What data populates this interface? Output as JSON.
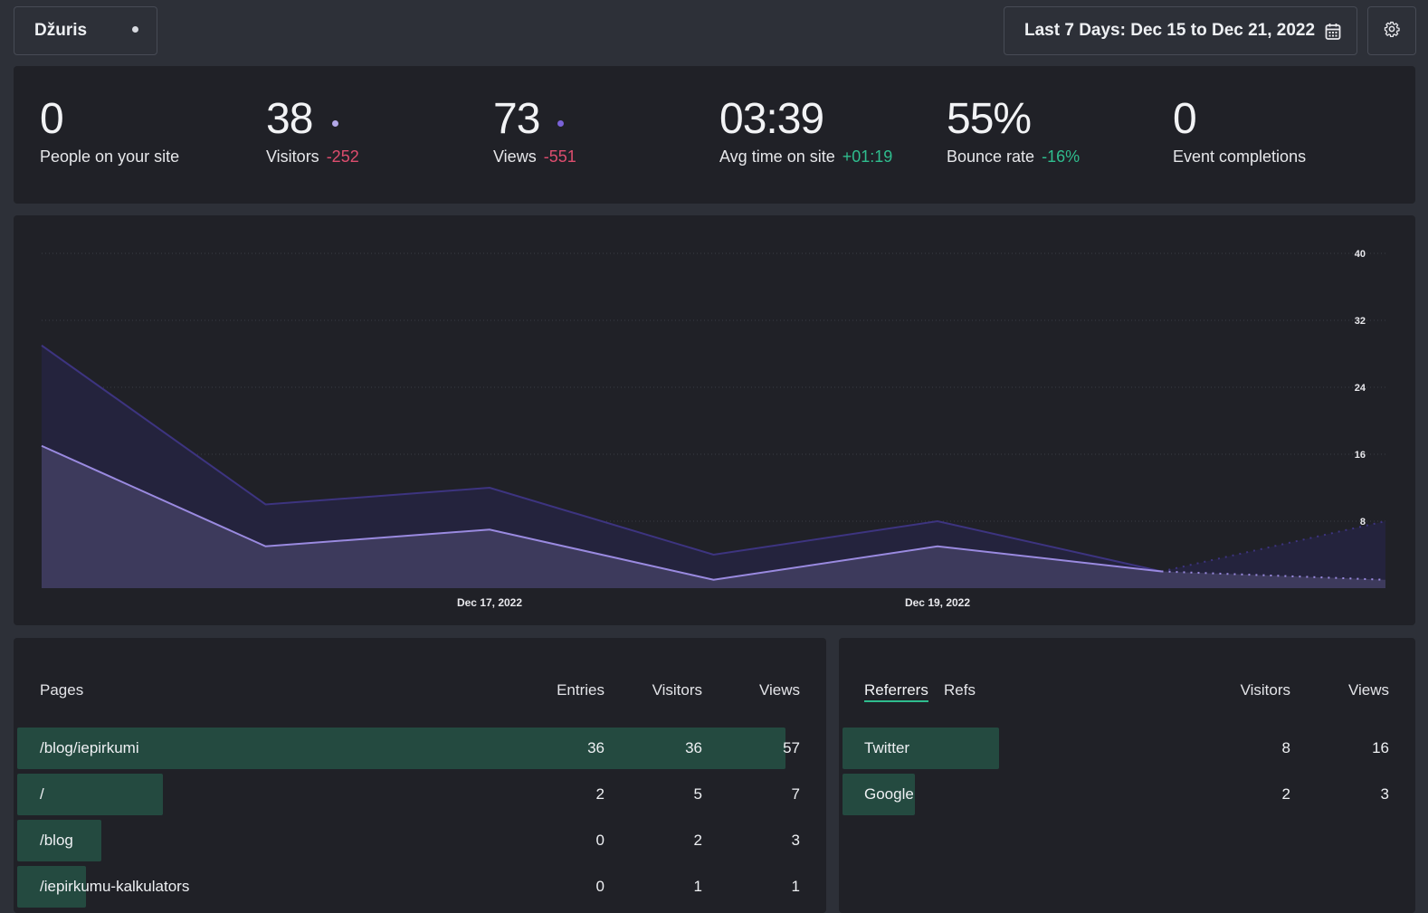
{
  "header": {
    "site_name": "Džuris",
    "date_range": "Last 7 Days: Dec 15 to Dec 21, 2022",
    "calendar_icon": "calendar-icon",
    "settings_icon": "gear-icon"
  },
  "stats": {
    "people": {
      "value": "0",
      "label": "People on your site"
    },
    "visitors": {
      "value": "38",
      "label": "Visitors",
      "delta": "-252"
    },
    "views": {
      "value": "73",
      "label": "Views",
      "delta": "-551"
    },
    "avg_time": {
      "value": "03:39",
      "label": "Avg time on site",
      "delta": "+01:19"
    },
    "bounce": {
      "value": "55%",
      "label": "Bounce rate",
      "delta": "-16%"
    },
    "events": {
      "value": "0",
      "label": "Event completions"
    }
  },
  "colors": {
    "negative": "#dd4d6e",
    "positive": "#2fbd8e",
    "visitors_dot": "#b3a8e8",
    "views_dot": "#7a62d8",
    "bar": "#244a40"
  },
  "chart_data": {
    "type": "area",
    "x": [
      "Dec 15, 2022",
      "Dec 16, 2022",
      "Dec 17, 2022",
      "Dec 18, 2022",
      "Dec 19, 2022",
      "Dec 20, 2022",
      "Dec 21, 2022"
    ],
    "x_tick_labels": [
      "Dec 17, 2022",
      "Dec 19, 2022"
    ],
    "y_ticks": [
      "8",
      "16",
      "24",
      "32",
      "40"
    ],
    "ylim": [
      0,
      40
    ],
    "series": [
      {
        "values": [
          29,
          10,
          12,
          4,
          8,
          2,
          8
        ],
        "color": "#3d3480",
        "fill": "#24233d"
      },
      {
        "values": [
          17,
          5,
          7,
          1,
          5,
          2,
          1
        ],
        "color": "#9a8ae0",
        "fill": "#3d3a5c"
      }
    ],
    "last_segment_dotted": true,
    "grid": true
  },
  "pages_table": {
    "headers": {
      "label": "Pages",
      "entries": "Entries",
      "visitors": "Visitors",
      "views": "Views"
    },
    "rows": [
      {
        "path": "/blog/iepirkumi",
        "entries": "36",
        "visitors": "36",
        "views": "57",
        "share": 1.0
      },
      {
        "path": "/",
        "entries": "2",
        "visitors": "5",
        "views": "7",
        "share": 0.19
      },
      {
        "path": "/blog",
        "entries": "0",
        "visitors": "2",
        "views": "3",
        "share": 0.11
      },
      {
        "path": "/iepirkumu-kalkulators",
        "entries": "0",
        "visitors": "1",
        "views": "1",
        "share": 0.09
      }
    ]
  },
  "referrers_table": {
    "tabs": {
      "active": "Referrers",
      "other": "Refs"
    },
    "headers": {
      "visitors": "Visitors",
      "views": "Views"
    },
    "rows": [
      {
        "source": "Twitter",
        "visitors": "8",
        "views": "16",
        "share": 1.0
      },
      {
        "source": "Google",
        "visitors": "2",
        "views": "3",
        "share": 0.46
      }
    ]
  }
}
